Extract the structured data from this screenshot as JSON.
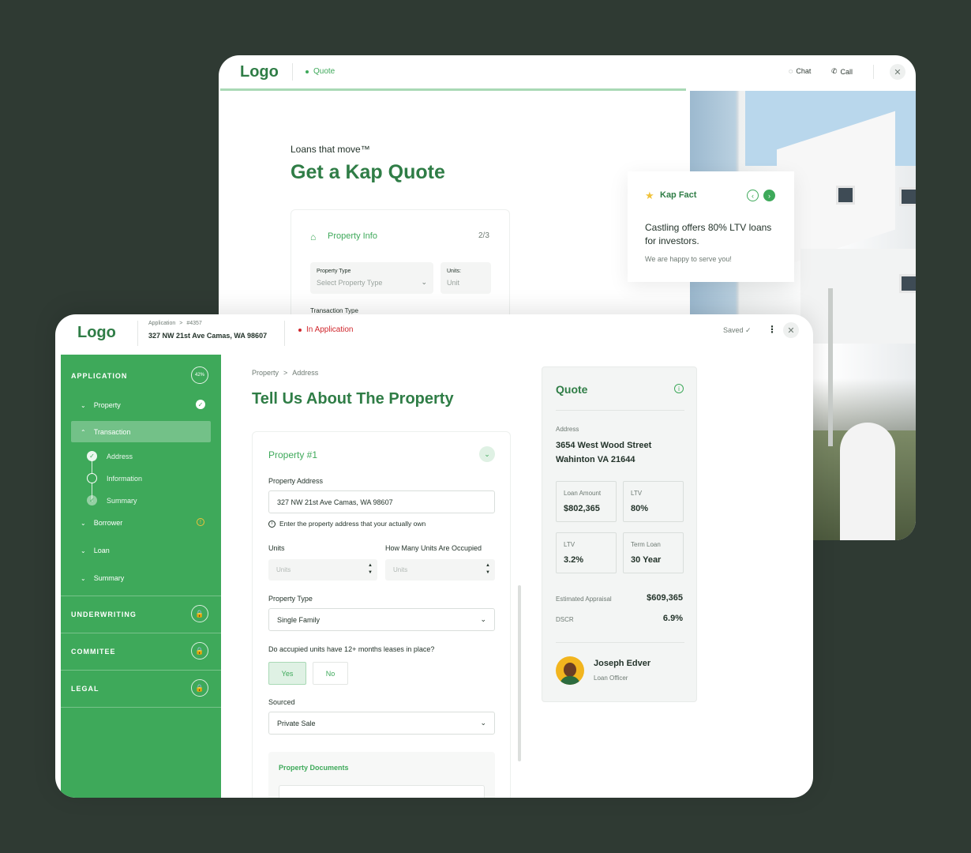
{
  "back": {
    "logo": "Logo",
    "quote_status": "Quote",
    "chat": "Chat",
    "call": "Call",
    "tagline": "Loans that move™",
    "title": "Get a Kap Quote",
    "card": {
      "title": "Property Info",
      "step": "2/3",
      "property_type_label": "Property Type",
      "property_type_placeholder": "Select Property Type",
      "units_label": "Units:",
      "units_placeholder": "Unit",
      "transaction_type_label": "Transaction Type"
    },
    "fact": {
      "title": "Kap Fact",
      "body": "Castling offers 80% LTV loans for investors.",
      "footer": "We are happy to serve you!"
    }
  },
  "front": {
    "logo": "Logo",
    "breadcrumb": {
      "root": "Application",
      "sep": ">",
      "id": "#4357"
    },
    "address": "327 NW 21st Ave Camas, WA 98607",
    "status": "In Application",
    "saved": "Saved ✓",
    "sidebar": {
      "application": {
        "title": "APPLICATION",
        "progress": "42%"
      },
      "items": {
        "property": "Property",
        "transaction": "Transaction",
        "address": "Address",
        "information": "Information",
        "summary_sub": "Summary",
        "borrower": "Borrower",
        "loan": "Loan",
        "summary": "Summary"
      },
      "sections": {
        "underwriting": "UNDERWRITING",
        "commitee": "COMMITEE",
        "legal": "LEGAL"
      }
    },
    "main": {
      "crumb_parent": "Property",
      "crumb_sep": ">",
      "crumb_current": "Address",
      "title": "Tell Us About The Property",
      "form": {
        "card_title": "Property #1",
        "address_label": "Property Address",
        "address_value": "327 NW 21st Ave Camas, WA 98607",
        "address_hint": "Enter the property address that your actually own",
        "units_label": "Units",
        "units_placeholder": "Units",
        "occupied_label": "How Many Units Are Occupied",
        "occupied_placeholder": "Units",
        "type_label": "Property Type",
        "type_value": "Single Family",
        "lease_question": "Do accupied units have 12+ months leases in place?",
        "yes": "Yes",
        "no": "No",
        "sourced_label": "Sourced",
        "sourced_value": "Private Sale",
        "docs_title": "Property Documents"
      }
    },
    "quote": {
      "title": "Quote",
      "address_label": "Address",
      "address_line1": "3654 West Wood Street",
      "address_line2": "Wahinton VA 21644",
      "metrics": [
        {
          "label": "Loan Amount",
          "value": "$802,365"
        },
        {
          "label": "LTV",
          "value": "80%"
        },
        {
          "label": "LTV",
          "value": "3.2%"
        },
        {
          "label": "Term Loan",
          "value": "30 Year"
        }
      ],
      "appraisal_label": "Estimated Appraisal",
      "appraisal_value": "$609,365",
      "dscr_label": "DSCR",
      "dscr_value": "6.9%",
      "officer_name": "Joseph Edver",
      "officer_role": "Loan Officer"
    }
  },
  "colors": {
    "brand_green": "#3ea95a",
    "title_green": "#2f7d46",
    "status_red": "#d0262c",
    "background": "#2f3a33"
  }
}
